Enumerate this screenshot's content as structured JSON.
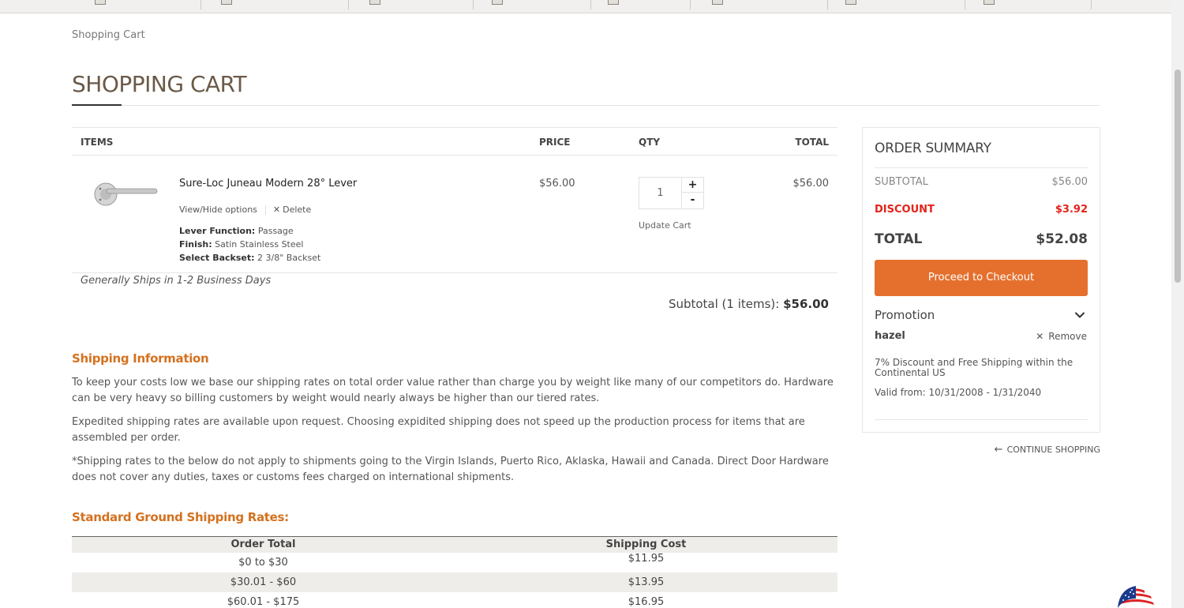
{
  "breadcrumb": "Shopping Cart",
  "page_title": "SHOPPING CART",
  "cart": {
    "headers": {
      "items": "ITEMS",
      "price": "PRICE",
      "qty": "QTY",
      "total": "TOTAL"
    },
    "item": {
      "name": "Sure-Loc Juneau Modern 28° Lever",
      "view_options": "View/Hide options",
      "delete": "Delete",
      "options": [
        {
          "label": "Lever Function:",
          "value": "Passage"
        },
        {
          "label": "Finish:",
          "value": "Satin Stainless Steel"
        },
        {
          "label": "Select Backset:",
          "value": "2 3/8\" Backset"
        }
      ],
      "price": "$56.00",
      "quantity": "1",
      "plus": "+",
      "minus": "-",
      "update_cart": "Update Cart",
      "total": "$56.00"
    },
    "ships_note": "Generally Ships in 1-2 Business Days",
    "subtotal_label": "Subtotal (1 items):",
    "subtotal_value": "$56.00"
  },
  "shipping_info": {
    "heading": "Shipping Information",
    "paragraphs": [
      "To keep your costs low we base our shipping rates on total order value rather than charge you by weight like many of our competitors do. Hardware can be very heavy so billing customers by weight would nearly always be higher than our tiered rates.",
      "Expedited shipping rates are available upon request. Choosing expidited shipping does not speed up the production process for items that are assembled per order.",
      "*Shipping rates to the below do not apply to shipments going to the Virgin Islands, Puerto Rico, Aklaska, Hawaii and Canada. Direct Door Hardware does not cover any duties, taxes or customs fees charged on international shipments."
    ]
  },
  "rates": {
    "heading": "Standard Ground Shipping Rates:",
    "col_order": "Order Total",
    "col_cost": "Shipping Cost",
    "rows": [
      {
        "order": "$0 to $30",
        "cost": "$11.95"
      },
      {
        "order": "$30.01 - $60",
        "cost": "$13.95"
      },
      {
        "order": "$60.01 - $175",
        "cost": "$16.95"
      }
    ]
  },
  "summary": {
    "title": "ORDER SUMMARY",
    "subtotal_label": "SUBTOTAL",
    "subtotal_value": "$56.00",
    "discount_label": "DISCOUNT",
    "discount_value": "$3.92",
    "total_label": "TOTAL",
    "total_value": "$52.08",
    "checkout_label": "Proceed to Checkout",
    "promotion_label": "Promotion",
    "promo_code": "hazel",
    "remove_label": "Remove",
    "promo_description": "7% Discount and Free Shipping within the Continental US",
    "promo_valid": "Valid from: 10/31/2008 - 1/31/2040"
  },
  "continue_shopping": "CONTINUE SHOPPING",
  "colors": {
    "accent_orange": "#e5702e",
    "heading_orange": "#d4711f",
    "discount_red": "#e2231a",
    "title_brown": "#6b5a48"
  }
}
